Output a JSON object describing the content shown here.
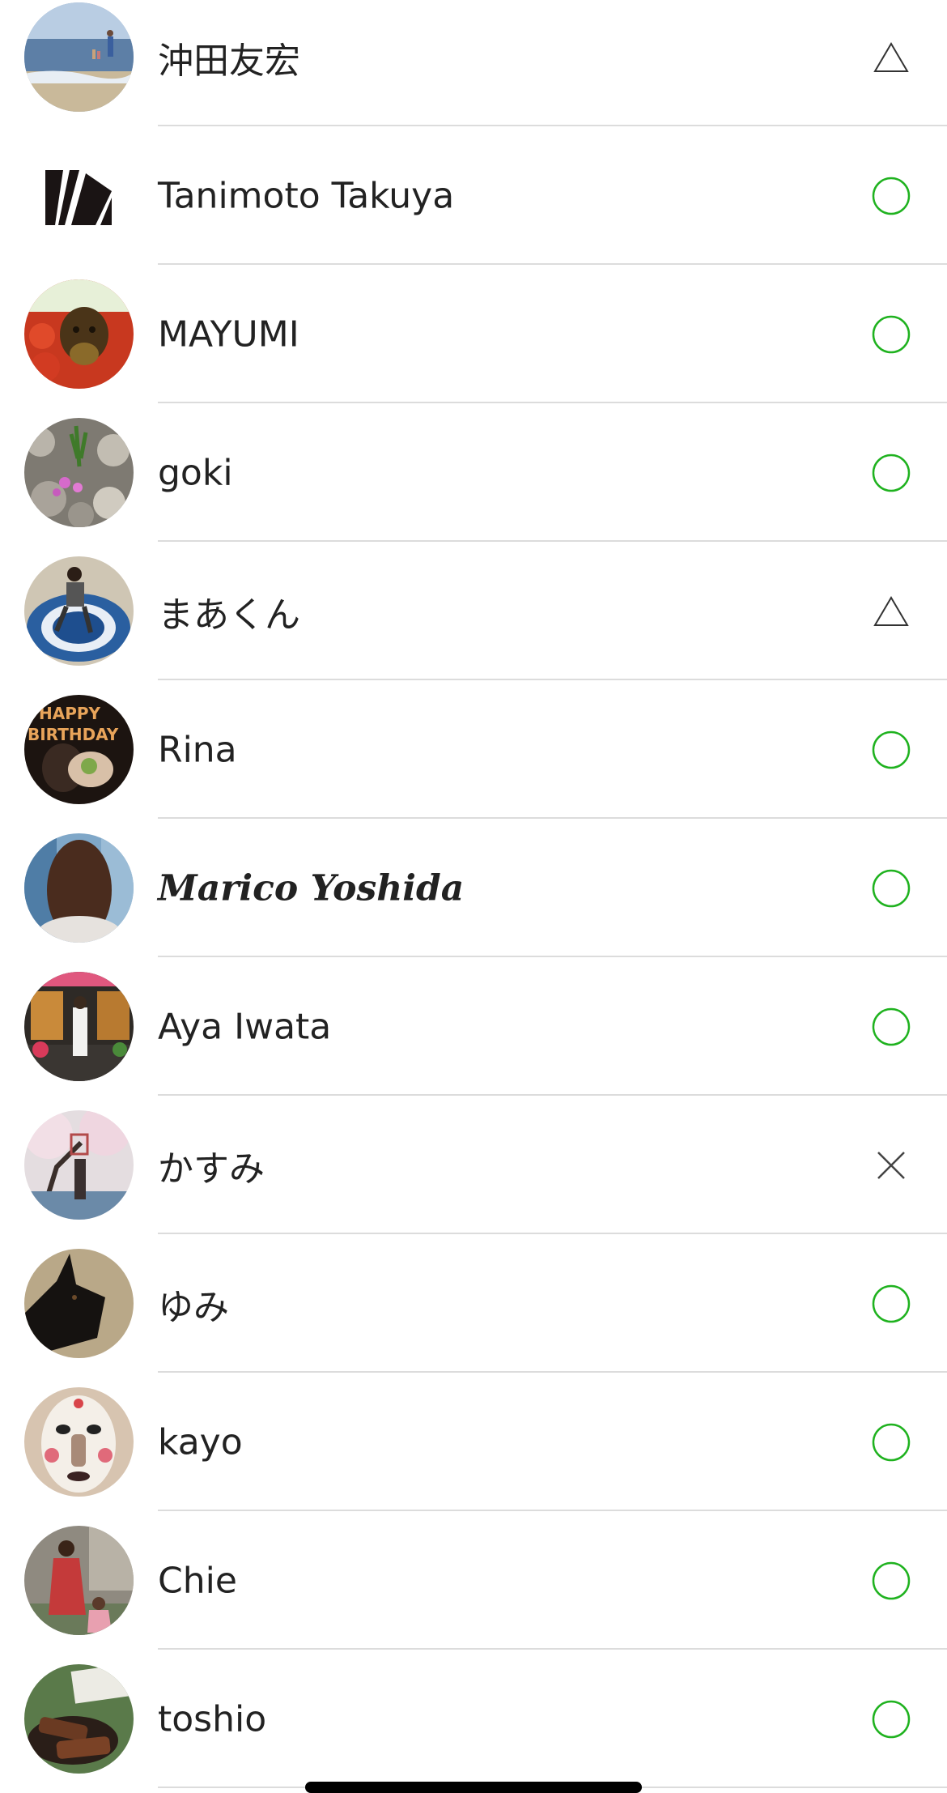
{
  "friends": [
    {
      "name": "沖田友宏",
      "status": "triangle-icon",
      "avatar": "beach-photo-avatar"
    },
    {
      "name": "Tanimoto Takuya",
      "status": "circle-icon",
      "avatar": "logo-avatar"
    },
    {
      "name": "MAYUMI",
      "status": "circle-icon",
      "avatar": "dog-photo-avatar"
    },
    {
      "name": "goki",
      "status": "circle-icon",
      "avatar": "rocks-flowers-avatar"
    },
    {
      "name": "まあくん",
      "status": "triangle-icon",
      "avatar": "person-on-rug-avatar"
    },
    {
      "name": "Rina",
      "status": "circle-icon",
      "avatar": "birthday-photo-avatar"
    },
    {
      "name": "Marico Yoshida",
      "status": "circle-icon",
      "avatar": "woman-hair-avatar"
    },
    {
      "name": "Aya Iwata",
      "status": "circle-icon",
      "avatar": "shopfront-avatar"
    },
    {
      "name": "かすみ",
      "status": "cross-icon",
      "avatar": "cherry-blossom-avatar"
    },
    {
      "name": "ゆみ",
      "status": "circle-icon",
      "avatar": "black-dog-avatar"
    },
    {
      "name": "kayo",
      "status": "circle-icon",
      "avatar": "mask-avatar"
    },
    {
      "name": "Chie",
      "status": "circle-icon",
      "avatar": "mother-child-avatar"
    },
    {
      "name": "toshio",
      "status": "circle-icon",
      "avatar": "food-avatar"
    }
  ],
  "colors": {
    "circle": "#1fb21f",
    "triangle": "#333333",
    "cross": "#444444",
    "divider": "#dcdcdc"
  }
}
